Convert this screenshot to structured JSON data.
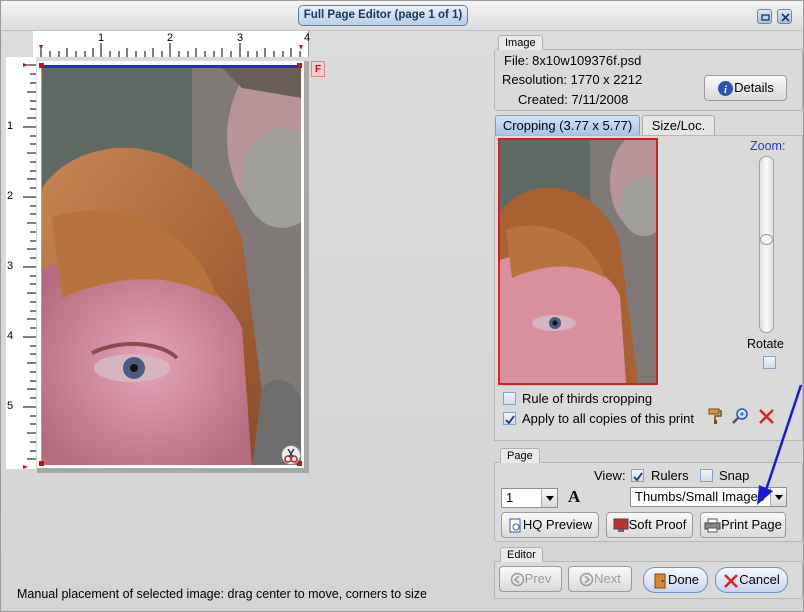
{
  "window": {
    "title": "Full Page Editor (page 1 of 1)"
  },
  "ruler": {
    "top_ticks": [
      "1",
      "2",
      "3",
      "4"
    ],
    "left_ticks": [
      "1",
      "2",
      "3",
      "4",
      "5"
    ]
  },
  "page_marker": "F",
  "status": "Manual placement of selected image: drag center to move, corners to size",
  "image_group": {
    "label": "Image",
    "file": "File: 8x10w109376f.psd",
    "resolution": "Resolution: 1770 x 2212",
    "created": "Created: 7/11/2008",
    "details_label": "Details"
  },
  "tabs": [
    {
      "label": "Cropping (3.77 x 5.77)"
    },
    {
      "label": "Size/Loc."
    }
  ],
  "cropping": {
    "zoom_label": "Zoom:",
    "zoom_level": 0.47,
    "rotate_label": "Rotate",
    "rule_of_thirds_label": "Rule of thirds cropping",
    "apply_all_label": "Apply to all copies of this print"
  },
  "page_group": {
    "label": "Page",
    "view_label": "View:",
    "rulers_label": "Rulers",
    "snap_label": "Snap",
    "copies_value": "1",
    "font_glyph": "A",
    "view_select_value": "Thumbs/Small Images",
    "hq_preview_label": "HQ Preview",
    "soft_proof_label": "Soft Proof",
    "print_page_label": "Print Page"
  },
  "editor_group": {
    "label": "Editor",
    "prev_label": "Prev",
    "next_label": "Next",
    "done_label": "Done",
    "cancel_label": "Cancel"
  },
  "colors": {
    "accent": "#1a3bd8",
    "crop_border": "#d42020",
    "arrow": "#1a1ad8"
  }
}
